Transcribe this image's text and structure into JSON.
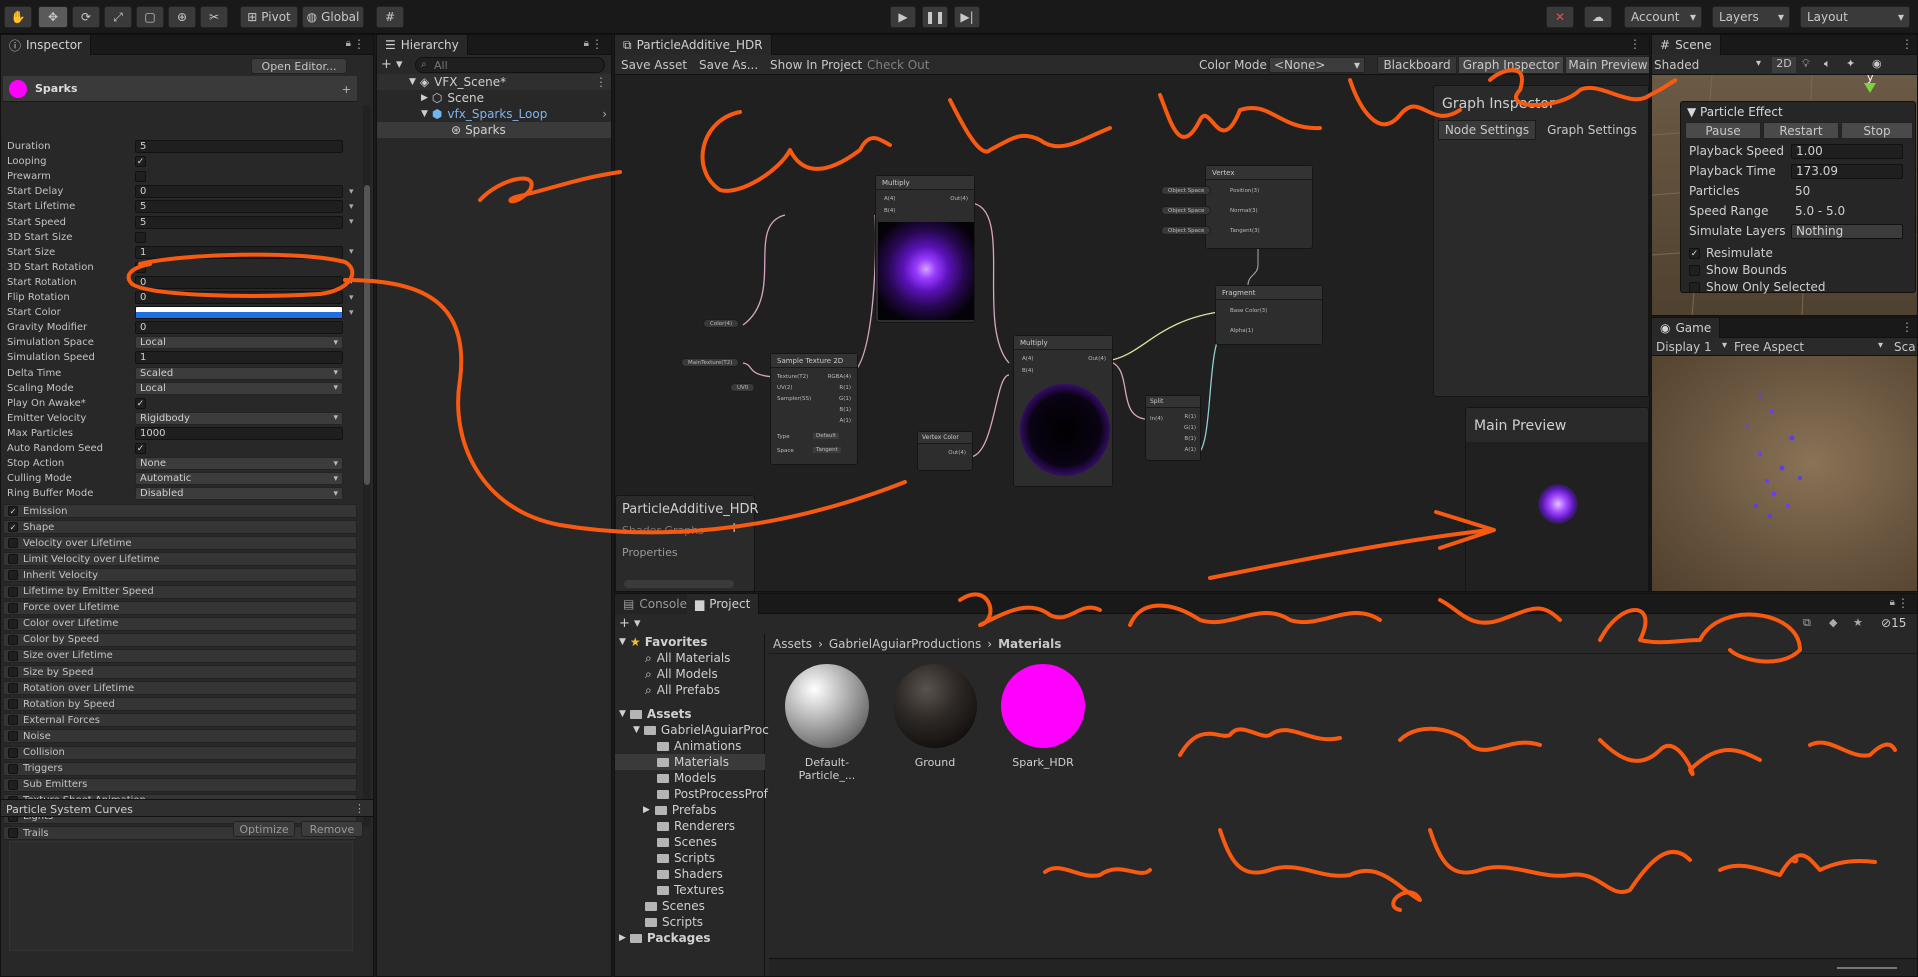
{
  "toolbar": {
    "pivot_label": "Pivot",
    "global_label": "Global",
    "account_label": "Account",
    "layers_label": "Layers",
    "layout_label": "Layout"
  },
  "inspector": {
    "tab_label": "Inspector",
    "open_editor": "Open Editor...",
    "component_name": "Sparks",
    "props": [
      {
        "label": "Duration",
        "kind": "field",
        "value": "5"
      },
      {
        "label": "Looping",
        "kind": "check",
        "value": "✓"
      },
      {
        "label": "Prewarm",
        "kind": "check",
        "value": ""
      },
      {
        "label": "Start Delay",
        "kind": "field",
        "value": "0"
      },
      {
        "label": "Start Lifetime",
        "kind": "field",
        "value": "5"
      },
      {
        "label": "Start Speed",
        "kind": "field",
        "value": "5"
      },
      {
        "label": "3D Start Size",
        "kind": "check",
        "value": ""
      },
      {
        "label": "Start Size",
        "kind": "field",
        "value": "1"
      },
      {
        "label": "3D Start Rotation",
        "kind": "check",
        "value": ""
      },
      {
        "label": "Start Rotation",
        "kind": "field",
        "value": "0"
      },
      {
        "label": "Flip Rotation",
        "kind": "field",
        "value": "0"
      },
      {
        "label": "Start Color",
        "kind": "color",
        "value": ""
      },
      {
        "label": "Gravity Modifier",
        "kind": "field",
        "value": "0"
      },
      {
        "label": "Simulation Space",
        "kind": "drop",
        "value": "Local"
      },
      {
        "label": "Simulation Speed",
        "kind": "field",
        "value": "1"
      },
      {
        "label": "Delta Time",
        "kind": "drop",
        "value": "Scaled"
      },
      {
        "label": "Scaling Mode",
        "kind": "drop",
        "value": "Local"
      },
      {
        "label": "Play On Awake*",
        "kind": "check",
        "value": "✓"
      },
      {
        "label": "Emitter Velocity",
        "kind": "drop",
        "value": "Rigidbody"
      },
      {
        "label": "Max Particles",
        "kind": "field",
        "value": "1000"
      },
      {
        "label": "Auto Random Seed",
        "kind": "check",
        "value": "✓"
      },
      {
        "label": "Stop Action",
        "kind": "drop",
        "value": "None"
      },
      {
        "label": "Culling Mode",
        "kind": "drop",
        "value": "Automatic"
      },
      {
        "label": "Ring Buffer Mode",
        "kind": "drop",
        "value": "Disabled"
      }
    ],
    "modules": [
      {
        "label": "Emission",
        "checked": "✓"
      },
      {
        "label": "Shape",
        "checked": "✓"
      },
      {
        "label": "Velocity over Lifetime",
        "checked": ""
      },
      {
        "label": "Limit Velocity over Lifetime",
        "checked": ""
      },
      {
        "label": "Inherit Velocity",
        "checked": ""
      },
      {
        "label": "Lifetime by Emitter Speed",
        "checked": ""
      },
      {
        "label": "Force over Lifetime",
        "checked": ""
      },
      {
        "label": "Color over Lifetime",
        "checked": ""
      },
      {
        "label": "Color by Speed",
        "checked": ""
      },
      {
        "label": "Size over Lifetime",
        "checked": ""
      },
      {
        "label": "Size by Speed",
        "checked": ""
      },
      {
        "label": "Rotation over Lifetime",
        "checked": ""
      },
      {
        "label": "Rotation by Speed",
        "checked": ""
      },
      {
        "label": "External Forces",
        "checked": ""
      },
      {
        "label": "Noise",
        "checked": ""
      },
      {
        "label": "Collision",
        "checked": ""
      },
      {
        "label": "Triggers",
        "checked": ""
      },
      {
        "label": "Sub Emitters",
        "checked": ""
      },
      {
        "label": "Texture Sheet Animation",
        "checked": ""
      },
      {
        "label": "Lights",
        "checked": ""
      },
      {
        "label": "Trails",
        "checked": ""
      }
    ],
    "curves_title": "Particle System Curves",
    "optimize": "Optimize",
    "remove": "Remove"
  },
  "hierarchy": {
    "tab_label": "Hierarchy",
    "search_placeholder": "All",
    "scene_name": "VFX_Scene*",
    "items": [
      "Scene",
      "vfx_Sparks_Loop",
      "Sparks"
    ]
  },
  "graph": {
    "tab_label": "ParticleAdditive_HDR",
    "save_asset": "Save Asset",
    "save_as": "Save As...",
    "show_in_project": "Show In Project",
    "check_out": "Check Out",
    "color_mode_label": "Color Mode",
    "color_mode_value": "<None>",
    "blackboard": "Blackboard",
    "graph_inspector": "Graph Inspector",
    "main_preview": "Main Preview",
    "inspector_title": "Graph Inspector",
    "node_settings": "Node Settings",
    "graph_settings": "Graph Settings",
    "blackboard_title": "ParticleAdditive_HDR",
    "blackboard_sub": "Shader Graphs",
    "blackboard_props": "Properties",
    "preview_title": "Main Preview",
    "nodes": {
      "multiply1": "Multiply",
      "multiply2": "Multiply",
      "sample": "Sample Texture 2D",
      "vertex_color": "Vertex Color",
      "split": "Split",
      "vertex": "Vertex",
      "fragment": "Fragment"
    },
    "ports": {
      "a": "A(4)",
      "b": "B(4)",
      "out": "Out(4)",
      "texture": "Texture(T2)",
      "uv": "UV(2)",
      "sampler": "Sampler(SS)",
      "rgba": "RGBA(4)",
      "r": "R(1)",
      "g": "G(1)",
      "bch": "B(1)",
      "ach": "A(1)",
      "type_label": "Type",
      "type_value": "Default",
      "space_label": "Space",
      "space_value": "Tangent",
      "in": "In(4)",
      "position": "Position(3)",
      "normal": "Normal(3)",
      "tangent": "Tangent(3)",
      "object_space": "Object Space",
      "base_color": "Base Color(3)",
      "alpha": "Alpha(1)",
      "color_prop": "Color(4)",
      "main_tex": "MainTexture(T2)",
      "uv0": "UV0"
    }
  },
  "scene": {
    "tab_label": "Scene",
    "shaded": "Shaded",
    "mode_2d": "2D",
    "axis_y": "y",
    "particle_effect": "Particle Effect",
    "pause": "Pause",
    "restart": "Restart",
    "stop": "Stop",
    "rows": [
      {
        "label": "Playback Speed",
        "value": "1.00"
      },
      {
        "label": "Playback Time",
        "value": "173.09"
      },
      {
        "label": "Particles",
        "value": "50"
      },
      {
        "label": "Speed Range",
        "value": "5.0 - 5.0"
      },
      {
        "label": "Simulate Layers",
        "value": "Nothing"
      }
    ],
    "checks": [
      {
        "label": "Resimulate",
        "checked": "✓"
      },
      {
        "label": "Show Bounds",
        "checked": ""
      },
      {
        "label": "Show Only Selected",
        "checked": ""
      }
    ]
  },
  "game": {
    "tab_label": "Game",
    "display": "Display 1",
    "aspect": "Free Aspect",
    "scale": "Sca"
  },
  "project": {
    "console_tab": "Console",
    "project_tab": "Project",
    "hidden_count": "15",
    "breadcrumb": [
      "Assets",
      "GabrielAguiarProductions",
      "Materials"
    ],
    "favorites_label": "Favorites",
    "favorites": [
      "All Materials",
      "All Models",
      "All Prefabs"
    ],
    "assets_label": "Assets",
    "root_folder": "GabrielAguiarProc",
    "subfolders": [
      "Animations",
      "Materials",
      "Models",
      "PostProcessProf",
      "Prefabs",
      "Renderers",
      "Scenes",
      "Scripts",
      "Shaders",
      "Textures"
    ],
    "asset_folders": [
      "Scenes",
      "Scripts"
    ],
    "packages_label": "Packages",
    "assets": [
      {
        "name": "Default-Particle_...",
        "color": "#b4b4b4"
      },
      {
        "name": "Ground",
        "color": "#2a2624"
      },
      {
        "name": "Spark_HDR",
        "color": "#ff00ff"
      }
    ]
  },
  "annotations": {
    "stroke_color": "#f75a10",
    "note1": "Some Colors don't work, try Blue",
    "note2": "also remember this is 2D",
    "note3": "make sure you are",
    "note4": "not looking through side."
  },
  "colors": {
    "spark_magenta": "#ff00ff",
    "start_color_blue": "#1e6fe0",
    "accent_blue": "#3d6fb6"
  }
}
